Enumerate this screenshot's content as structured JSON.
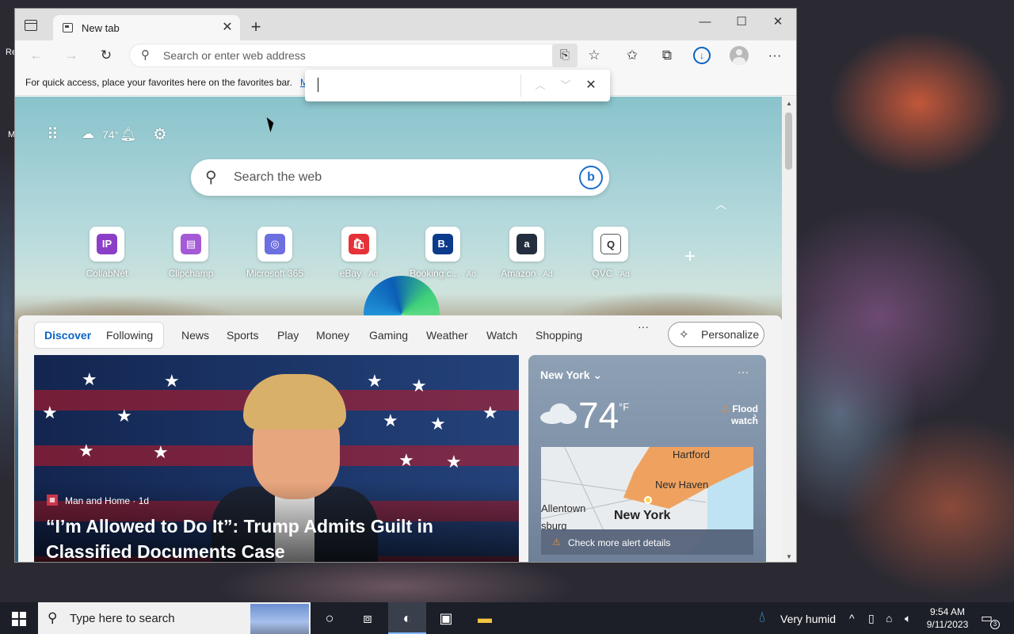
{
  "desktop": {
    "fragments": [
      "Re",
      "M"
    ]
  },
  "browser": {
    "tab": {
      "title": "New tab",
      "close": "✕"
    },
    "new_tab": "+",
    "window_controls": {
      "minimize": "—",
      "maximize": "☐",
      "close": "✕"
    },
    "address": {
      "placeholder": "Search or enter web address",
      "value": ""
    },
    "favorites_bar": {
      "text": "For quick access, place your favorites here on the favorites bar.",
      "link": "M"
    },
    "find_bar": {
      "value": "",
      "prev": "︿",
      "next": "﹀",
      "close": "✕"
    }
  },
  "ntp": {
    "weather_mini": {
      "temp": "74°"
    },
    "search": {
      "placeholder": "Search the web",
      "bing_label": "b"
    },
    "quick_links": [
      {
        "label": "CollabNet",
        "ad": "",
        "logo": "IP",
        "color": "#8b3fc7"
      },
      {
        "label": "Clipchamp",
        "ad": "",
        "logo": "▤",
        "color": "#a45ad6"
      },
      {
        "label": "Microsoft 365",
        "ad": "",
        "logo": "◎",
        "color": "#6b6fe0"
      },
      {
        "label": "eBay",
        "ad": "· Ad",
        "logo": "🛍",
        "color": "#e53238"
      },
      {
        "label": "Booking.c...",
        "ad": "· Ad",
        "logo": "B.",
        "color": "#0c3b8c"
      },
      {
        "label": "Amazon",
        "ad": "· Ad",
        "logo": "a",
        "color": "#232f3e"
      },
      {
        "label": "QVC",
        "ad": "· Ad",
        "logo": "Q",
        "color": "#ffffff"
      }
    ],
    "feed": {
      "tabs": [
        "Discover",
        "Following",
        "News",
        "Sports",
        "Play",
        "Money",
        "Gaming",
        "Weather",
        "Watch",
        "Shopping"
      ],
      "more": "···",
      "personalize": "Personalize",
      "hero": {
        "source": "Man and Home · 1d",
        "headline": "“I’m Allowed to Do It”: Trump Admits Guilt in Classified Documents Case"
      },
      "weather": {
        "city": "New York",
        "temp": "74",
        "unit": "°F",
        "alert": "Flood watch",
        "more": "···",
        "map_labels": [
          "Hartford",
          "New Haven",
          "Allentown",
          "sburg",
          "New York"
        ],
        "footer": "Check more alert details"
      }
    }
  },
  "taskbar": {
    "search_placeholder": "Type here to search",
    "weather": "Very humid",
    "time": "9:54 AM",
    "date": "9/11/2023",
    "notification_count": "3"
  }
}
